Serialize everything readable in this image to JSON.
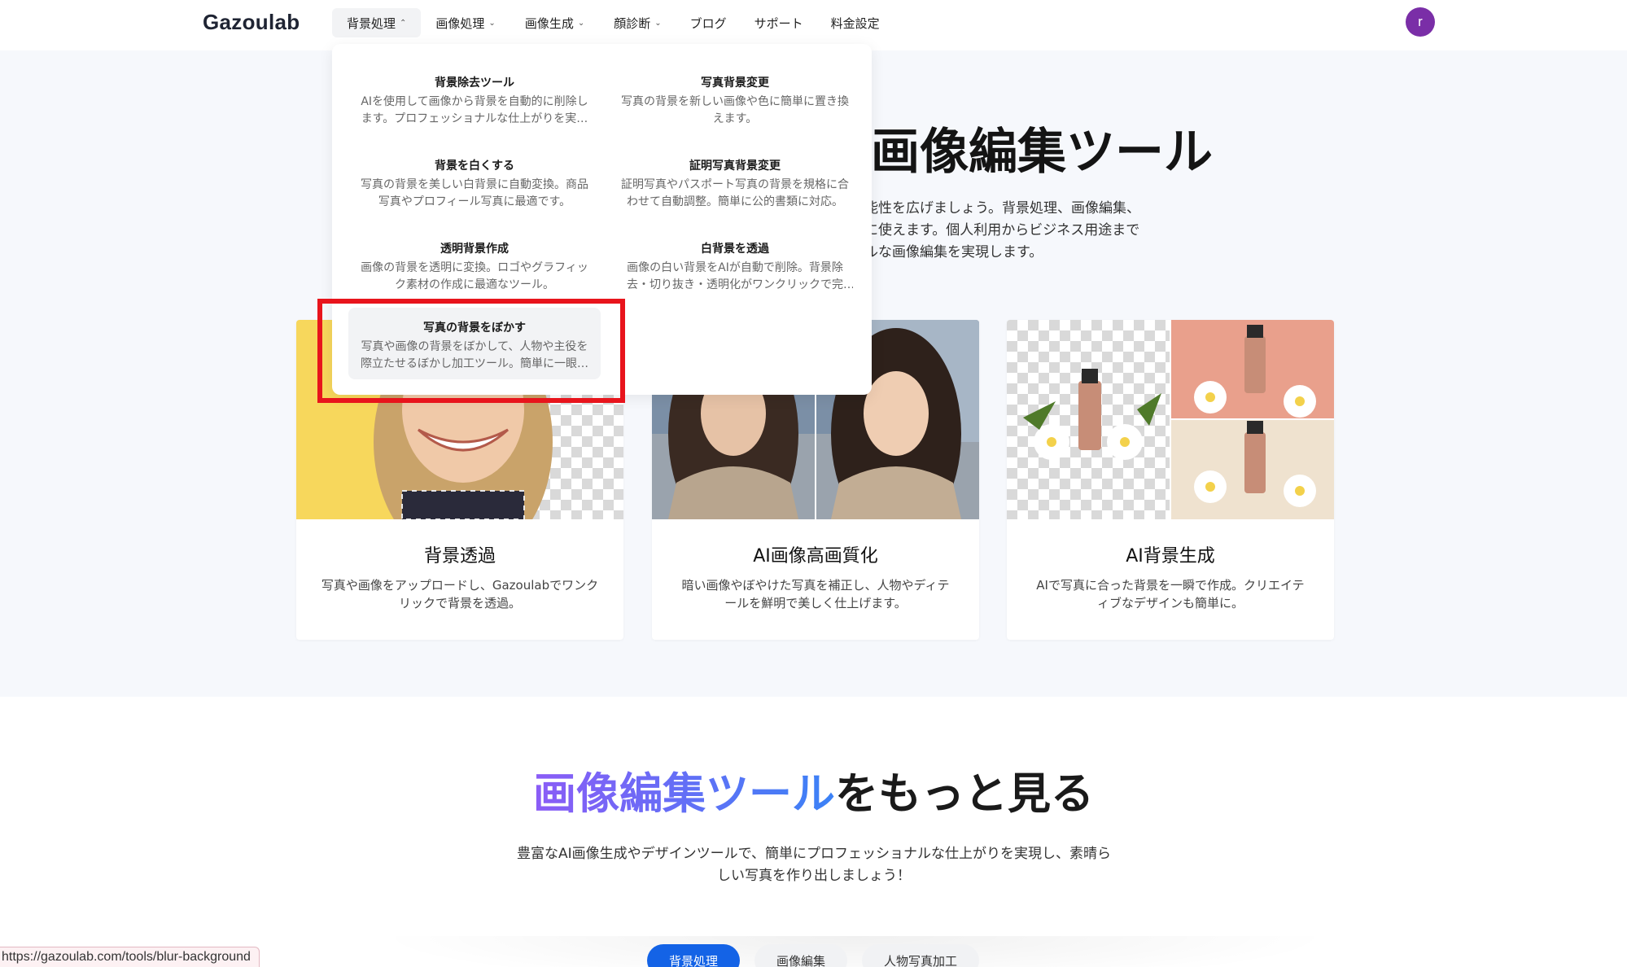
{
  "header": {
    "logo": "Gazoulab",
    "nav": [
      {
        "label": "背景処理",
        "chevron": "^"
      },
      {
        "label": "画像処理",
        "chevron": "v"
      },
      {
        "label": "画像生成",
        "chevron": "v"
      },
      {
        "label": "顔診断",
        "chevron": "v"
      },
      {
        "label": "ブログ"
      },
      {
        "label": "サポート"
      },
      {
        "label": "料金設定"
      }
    ],
    "avatar_initial": "r"
  },
  "dropdown": {
    "items": [
      {
        "title": "背景除去ツール",
        "desc": "AIを使用して画像から背景を自動的に削除します。プロフェッショナルな仕上がりを実現します。"
      },
      {
        "title": "写真背景変更",
        "desc": "写真の背景を新しい画像や色に簡単に置き換えます。"
      },
      {
        "title": "背景を白くする",
        "desc": "写真の背景を美しい白背景に自動変換。商品写真やプロフィール写真に最適です。"
      },
      {
        "title": "証明写真背景変更",
        "desc": "証明写真やパスポート写真の背景を規格に合わせて自動調整。簡単に公的書類に対応。"
      },
      {
        "title": "透明背景作成",
        "desc": "画像の背景を透明に変換。ロゴやグラフィック素材の作成に最適なツール。"
      },
      {
        "title": "白背景を透過",
        "desc": "画像の白い背景をAIが自動で削除。背景除去・切り抜き・透明化がワンクリックで完了。"
      },
      {
        "title": "写真の背景をぼかす",
        "desc": "写真や画像の背景をぼかして、人物や主役を際立たせるぼかし加工ツール。簡単に一眼レフ風に。"
      }
    ]
  },
  "hero": {
    "title_visible": "画像編集ツール",
    "desc_lines": [
      "能性を広げましょう。背景処理、画像編集、",
      "に使えます。個人利用からビジネス用途まで",
      "ルな画像編集を実現します。"
    ]
  },
  "cards": [
    {
      "title": "背景透過",
      "desc": "写真や画像をアップロードし、Gazoulabでワンクリックで背景を透過。"
    },
    {
      "title": "AI画像高画質化",
      "desc": "暗い画像やぼやけた写真を補正し、人物やディテールを鮮明で美しく仕上げます。"
    },
    {
      "title": "AI背景生成",
      "desc": "AIで写真に合った背景を一瞬で作成。クリエイティブなデザインも簡単に。"
    }
  ],
  "more": {
    "title_accent": "画像編集ツール",
    "title_rest": "をもっと見る",
    "desc": "豊富なAI画像生成やデザインツールで、簡単にプロフェッショナルな仕上がりを実現し、素晴らしい写真を作り出しましょう！",
    "tabs": [
      "背景処理",
      "画像編集",
      "人物写真加工"
    ]
  },
  "status_url": "https://gazoulab.com/tools/blur-background",
  "colors": {
    "accent_blue": "#1463e6",
    "avatar": "#7a2ea7",
    "highlight": "#e8141c"
  }
}
